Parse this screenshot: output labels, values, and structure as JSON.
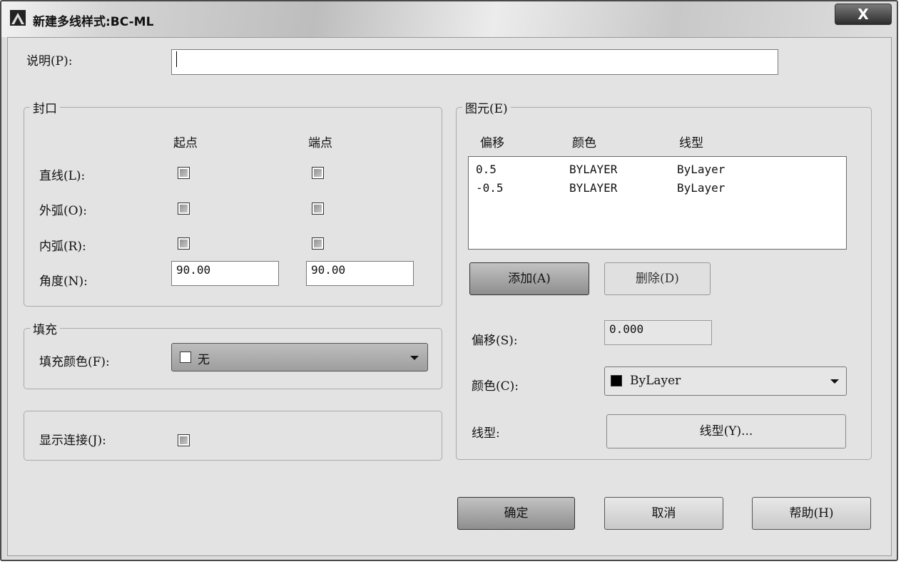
{
  "window": {
    "title": "新建多线样式:BC-ML",
    "close_glyph": "X"
  },
  "description": {
    "label": "说明(P):",
    "value": ""
  },
  "caps": {
    "title": "封口",
    "col_start": "起点",
    "col_end": "端点",
    "line_label": "直线(L):",
    "outer_arc_label": "外弧(O):",
    "inner_arc_label": "内弧(R):",
    "angle_label": "角度(N):",
    "angle_start": "90.00",
    "angle_end": "90.00"
  },
  "fill": {
    "title": "填充",
    "color_label": "填充颜色(F):",
    "color_value": "无"
  },
  "joints": {
    "label": "显示连接(J):"
  },
  "elements": {
    "title": "图元(E)",
    "headers": {
      "offset": "偏移",
      "color": "颜色",
      "linetype": "线型"
    },
    "rows": [
      {
        "offset": "0.5",
        "color": "BYLAYER",
        "linetype": "ByLayer"
      },
      {
        "offset": "-0.5",
        "color": "BYLAYER",
        "linetype": "ByLayer"
      }
    ],
    "add_button": "添加(A)",
    "delete_button": "删除(D)",
    "offset_label": "偏移(S):",
    "offset_value": "0.000",
    "color_label": "颜色(C):",
    "color_value": "ByLayer",
    "linetype_label": "线型:",
    "linetype_button": "线型(Y)..."
  },
  "footer": {
    "ok": "确定",
    "cancel": "取消",
    "help": "帮助(H)"
  },
  "colors": {
    "fill_swatch": "#ffffff",
    "color_swatch": "#000000"
  }
}
